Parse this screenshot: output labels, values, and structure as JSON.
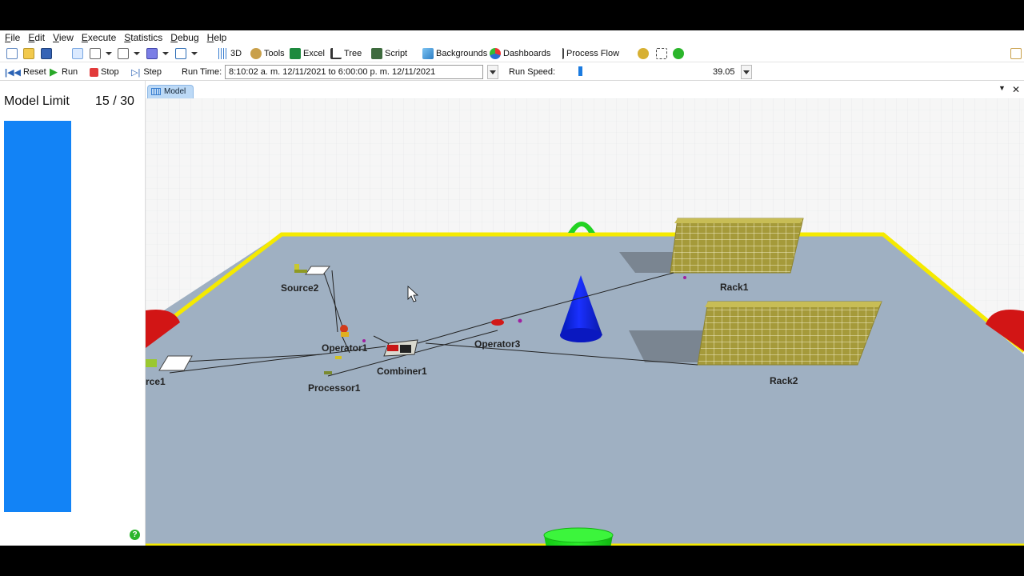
{
  "menu": [
    "File",
    "Edit",
    "View",
    "Execute",
    "Statistics",
    "Debug",
    "Help"
  ],
  "toolbar": {
    "view_3d": "3D",
    "tools": "Tools",
    "excel": "Excel",
    "tree": "Tree",
    "script": "Script",
    "backgrounds": "Backgrounds",
    "dashboards": "Dashboards",
    "process_flow": "Process Flow"
  },
  "run_controls": {
    "reset": "Reset",
    "run": "Run",
    "stop": "Stop",
    "step": "Step",
    "run_time_label": "Run Time:",
    "run_time_value": "8:10:02 a. m.  12/11/2021  to   6:00:00 p. m.  12/11/2021",
    "run_speed_label": "Run Speed:",
    "run_speed_value": "39.05"
  },
  "model_limit": {
    "label": "Model Limit",
    "count": "15 / 30",
    "used": 15,
    "max": 30
  },
  "tab": {
    "label": "Model"
  },
  "objects": {
    "source1": "rce1",
    "source2": "Source2",
    "operator1": "Operator1",
    "processor1": "Processor1",
    "combiner1": "Combiner1",
    "operator3": "Operator3",
    "rack1": "Rack1",
    "rack2": "Rack2"
  },
  "colors": {
    "floor": "#9fb0c2",
    "floor_border": "#f5ea00",
    "limit_bar": "#1283f6",
    "cone": "#0a1fe0",
    "cylinder": "#1ee61e",
    "rack": "#a59a3a"
  }
}
